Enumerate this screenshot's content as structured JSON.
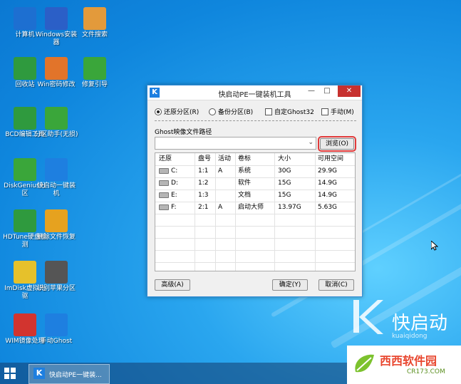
{
  "desktop": {
    "icons": [
      {
        "label": "计算机",
        "icon": "computer-icon",
        "color": "#1d6fd1"
      },
      {
        "label": "Windows安装器",
        "icon": "windows-installer-icon",
        "color": "#2b5fc7"
      },
      {
        "label": "文件搜索",
        "icon": "file-search-icon",
        "color": "#e39a3b"
      },
      {
        "label": "回收站",
        "icon": "recycle-bin-icon",
        "color": "#2f9a3e"
      },
      {
        "label": "Win密码修改",
        "icon": "password-lock-icon",
        "color": "#e2742a"
      },
      {
        "label": "修复引导",
        "icon": "runner-repair-icon",
        "color": "#3aa63a"
      },
      {
        "label": "BCD编辑工具",
        "icon": "gear-icon",
        "color": "#2f9a3e"
      },
      {
        "label": "分区助手(无损)",
        "icon": "partition-icon",
        "color": "#3aa63a"
      },
      {
        "label": "DiskGenius分区",
        "icon": "wrench-icon",
        "color": "#3aa63a"
      },
      {
        "label": "快启动一键装机",
        "icon": "k-logo-icon",
        "color": "#1e7fe0"
      },
      {
        "label": "HDTune硬盘检测",
        "icon": "clock-icon",
        "color": "#2f9a3e"
      },
      {
        "label": "删除文件恢复",
        "icon": "shield-check-icon",
        "color": "#e6a21f"
      },
      {
        "label": "ImDisk虚拟光驱",
        "icon": "disc-icon",
        "color": "#e6c12b"
      },
      {
        "label": "识别苹果分区",
        "icon": "apple-icon",
        "color": "#555555"
      },
      {
        "label": "WIM镜像处理",
        "icon": "wim-icon",
        "color": "#d2342f"
      },
      {
        "label": "手动Ghost",
        "icon": "ghost-icon",
        "color": "#1e7fe0"
      }
    ]
  },
  "window": {
    "title": "快启动PE一键装机工具",
    "minimize": "—",
    "maximize": "□",
    "close": "✕",
    "options": {
      "restore": "还原分区(R)",
      "backup": "备份分区(B)",
      "ghost32": "自定Ghost32",
      "manual": "手动(M)"
    },
    "path_label": "Ghost映像文件路径",
    "path_value": "",
    "browse": "浏览(O)",
    "table": {
      "headers": [
        "还原",
        "盘号",
        "活动",
        "卷标",
        "大小",
        "可用空间"
      ],
      "rows": [
        {
          "drive": "C:",
          "disk": "1:1",
          "active": "A",
          "label": "系统",
          "size": "30G",
          "free": "29.9G"
        },
        {
          "drive": "D:",
          "disk": "1:2",
          "active": "",
          "label": "软件",
          "size": "15G",
          "free": "14.9G"
        },
        {
          "drive": "E:",
          "disk": "1:3",
          "active": "",
          "label": "文档",
          "size": "15G",
          "free": "14.9G"
        },
        {
          "drive": "F:",
          "disk": "2:1",
          "active": "A",
          "label": "启动大师",
          "size": "13.97G",
          "free": "5.63G"
        }
      ]
    },
    "advanced": "高级(A)",
    "ok": "确定(Y)",
    "cancel": "取消(C)"
  },
  "watermark": {
    "brand": "快启动",
    "sub": "kuaiqidong"
  },
  "taskbar": {
    "task_label": "快启动PE一键装..."
  },
  "site_logo": {
    "text": "西西软件园",
    "url": "CR173.COM"
  }
}
